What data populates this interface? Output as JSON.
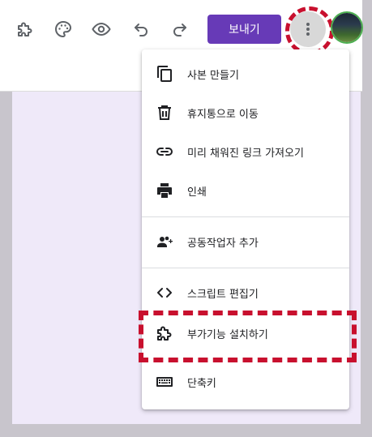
{
  "toolbar": {
    "icons": [
      "puzzle-icon",
      "palette-icon",
      "eye-icon",
      "undo-icon",
      "redo-icon"
    ],
    "send_label": "보내기",
    "more_icon": "more-vert-icon"
  },
  "menu": {
    "items": [
      {
        "label": "사본 만들기",
        "icon": "copy-icon"
      },
      {
        "label": "휴지통으로 이동",
        "icon": "trash-icon"
      },
      {
        "label": "미리 채워진 링크 가져오기",
        "icon": "link-icon"
      },
      {
        "label": "인쇄",
        "icon": "printer-icon"
      },
      {
        "label": "공동작업자 추가",
        "icon": "add-people-icon"
      },
      {
        "label": "스크립트 편집기",
        "icon": "code-icon"
      },
      {
        "label": "부가기능 설치하기",
        "icon": "puzzle-icon"
      },
      {
        "label": "단축키",
        "icon": "keyboard-icon"
      }
    ]
  },
  "colors": {
    "accent": "#673ab7",
    "highlight": "#c8102e",
    "canvas": "#efe9f9",
    "icon": "#5f6368"
  }
}
